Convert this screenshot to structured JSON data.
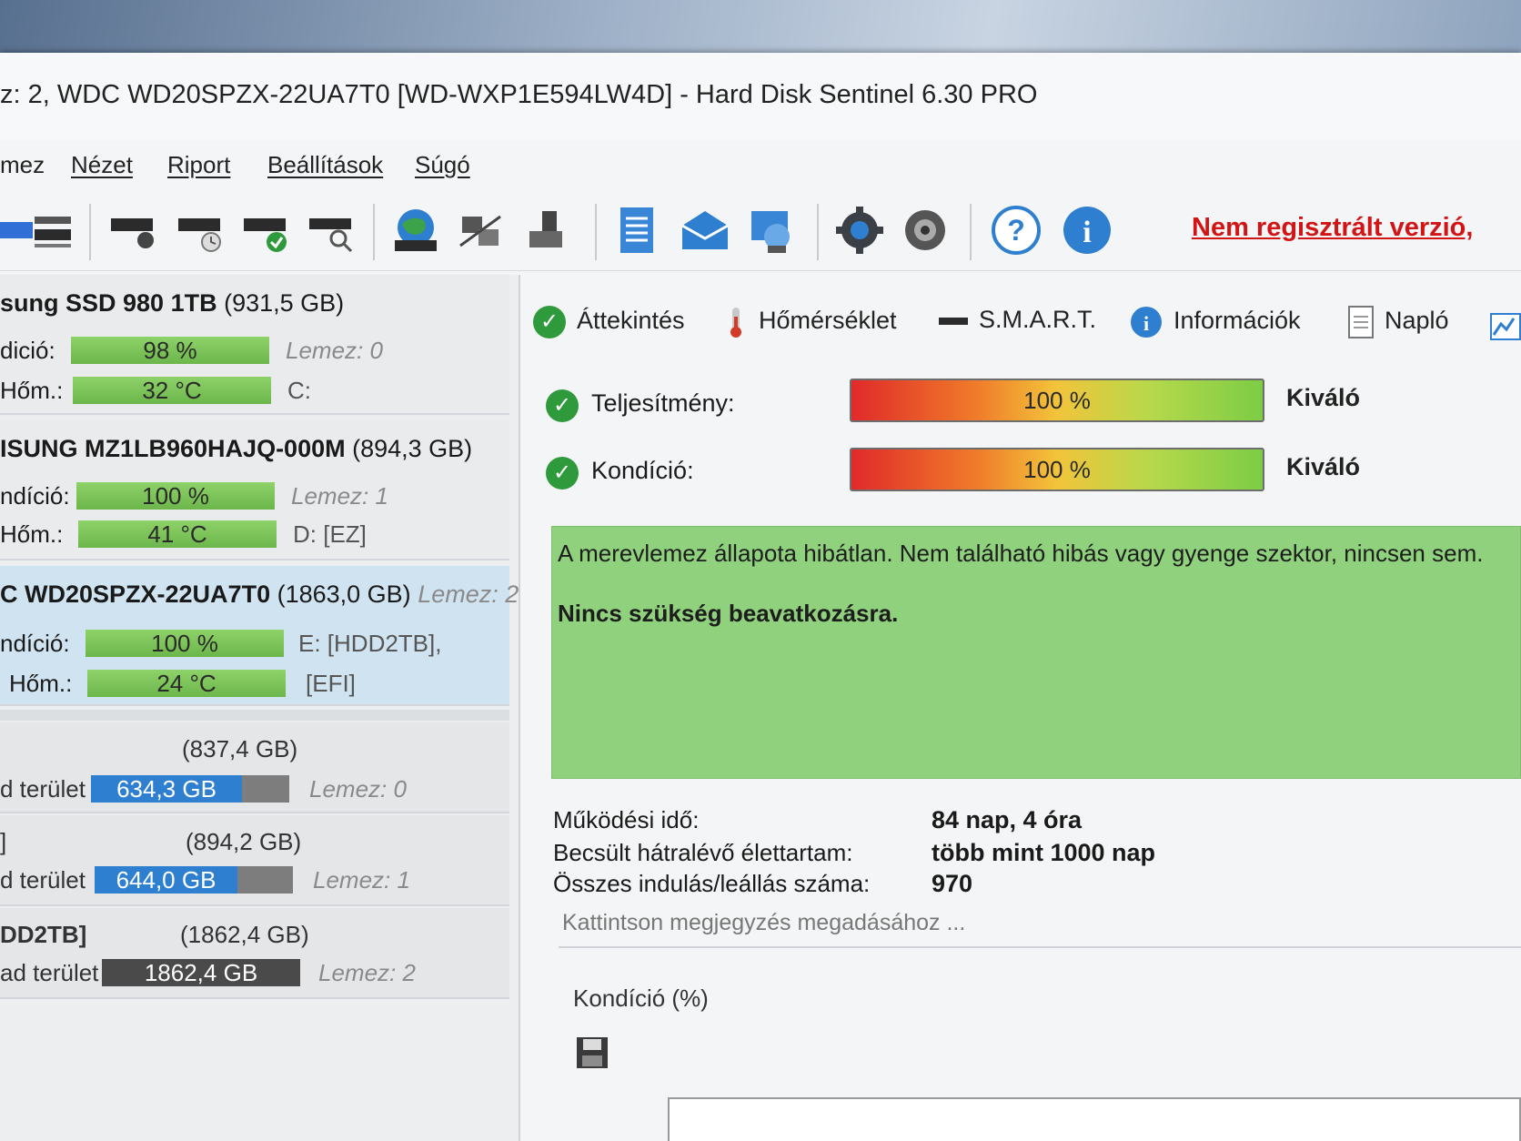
{
  "window": {
    "title": "z: 2, WDC WD20SPZX-22UA7T0 [WD-WXP1E594LW4D]  -  Hard Disk Sentinel 6.30 PRO"
  },
  "menu": [
    "mez",
    "Nézet",
    "Riport",
    "Beállítások",
    "Súgó"
  ],
  "toolbar": {
    "icons": [
      "disk-icon",
      "disk-list-icon",
      "disk-search-icon",
      "disk-clock-icon",
      "disk-check-icon",
      "disk-magnify-icon",
      "globe-icon",
      "network-icon",
      "usb-icon",
      "report-icon",
      "mail-icon",
      "web-icon",
      "gear-icon",
      "speaker-icon",
      "help-icon",
      "info-icon"
    ],
    "unregistered": "Nem regisztrált verzió,"
  },
  "disks": [
    {
      "name_bold": "sung SSD 980 1TB",
      "name_rest": " (931,5 GB)",
      "cond_label": "dició:",
      "cond_value": "98 %",
      "cond_pct": 98,
      "temp_label": "Hőm.:",
      "temp_value": "32 °C",
      "disk_label": "Lemez: 0",
      "drive": "C:",
      "drive2": ""
    },
    {
      "name_bold": "ISUNG MZ1LB960HAJQ-000M",
      "name_rest": " (894,3 GB)",
      "cond_label": "ndíció:",
      "cond_value": "100 %",
      "cond_pct": 100,
      "temp_label": "Hőm.:",
      "temp_value": "41 °C",
      "disk_label": "Lemez: 1",
      "drive": "D: [EZ]",
      "drive2": ""
    },
    {
      "name_bold": "C WD20SPZX-22UA7T0",
      "name_rest": " (1863,0 GB) ",
      "name_italic": "Lemez: 2",
      "cond_label": "ndíció:",
      "cond_value": "100 %",
      "cond_pct": 100,
      "temp_label": "Hőm.:",
      "temp_value": "24 °C",
      "drive": "E: [HDD2TB],",
      "drive2": "[EFI]"
    }
  ],
  "partitions": [
    {
      "title": "",
      "size": "(837,4 GB)",
      "free_label": "d terület",
      "free_value": "634,3 GB",
      "free_frac": 0.76,
      "disk_label": "Lemez: 0",
      "bar_color": "#2f7fd0"
    },
    {
      "title": "]",
      "size": "(894,2 GB)",
      "free_label": "d terület",
      "free_value": "644,0 GB",
      "free_frac": 0.72,
      "disk_label": "Lemez: 1",
      "bar_color": "#2f7fd0"
    },
    {
      "title": "DD2TB]",
      "size": "(1862,4 GB)",
      "free_label": "ad terület",
      "free_value": "1862,4 GB",
      "free_frac": 1.0,
      "disk_label": "Lemez: 2",
      "bar_color": "#4a4a4a"
    }
  ],
  "tabs": [
    {
      "label": "Áttekintés",
      "icon": "check-circle-icon"
    },
    {
      "label": "Hőmérséklet",
      "icon": "thermometer-icon"
    },
    {
      "label": "S.M.A.R.T.",
      "icon": "smart-icon"
    },
    {
      "label": "Információk",
      "icon": "info-icon"
    },
    {
      "label": "Napló",
      "icon": "log-icon"
    }
  ],
  "metrics": [
    {
      "label": "Teljesítmény:",
      "value": "100 %",
      "pct": 100,
      "grade": "Kiváló"
    },
    {
      "label": "Kondíció:",
      "value": "100 %",
      "pct": 100,
      "grade": "Kiváló"
    }
  ],
  "status": {
    "text": "A merevlemez állapota hibátlan. Nem található hibás vagy gyenge szektor, nincsen sem.",
    "action": "Nincs szükség beavatkozásra."
  },
  "info": [
    {
      "label": "Működési idő:",
      "value": "84 nap, 4 óra"
    },
    {
      "label": "Becsült hátralévő élettartam:",
      "value": "több mint 1000 nap"
    },
    {
      "label": "Összes indulás/leállás száma:",
      "value": "970"
    }
  ],
  "note_placeholder": "Kattintson megjegyzés megadásához ...",
  "chart_label": "Kondíció  (%)",
  "colors": {
    "status_green": "#8fd17c",
    "accent_red": "#d21414",
    "selected": "#cfe3f0"
  }
}
